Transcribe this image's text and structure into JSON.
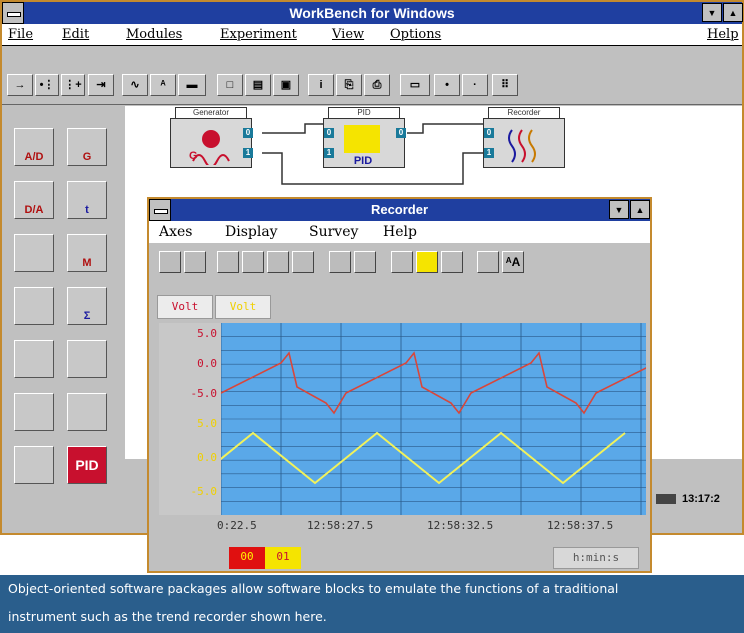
{
  "app": {
    "title": "WorkBench for Windows",
    "menu": [
      "File",
      "Edit",
      "Modules",
      "Experiment",
      "View",
      "Options"
    ],
    "help": "Help",
    "status_time": "13:17:2"
  },
  "palette": {
    "items": [
      {
        "label": "A/D"
      },
      {
        "label": "G"
      },
      {
        "label": "D/A"
      },
      {
        "label": "t"
      },
      {
        "label": ""
      },
      {
        "label": "M"
      },
      {
        "label": ""
      },
      {
        "label": "Σ"
      },
      {
        "label": ""
      },
      {
        "label": ""
      },
      {
        "label": ""
      },
      {
        "label": ""
      },
      {
        "label": ""
      },
      {
        "label": "PID"
      }
    ]
  },
  "diagram": {
    "blocks": [
      {
        "title": "Generator"
      },
      {
        "title": "PID",
        "caption": "PID"
      },
      {
        "title": "Recorder"
      }
    ],
    "port_labels": [
      "0",
      "1"
    ]
  },
  "recorder": {
    "title": "Recorder",
    "menu": [
      "Axes",
      "Display",
      "Survey",
      "Help"
    ],
    "unit_tabs": [
      "Volt",
      "Volt"
    ],
    "chart_data": {
      "type": "line",
      "yticks": [
        "5.0",
        "0.0",
        "-5.0",
        "5.0",
        "0.0",
        "-5.0"
      ],
      "xticks": [
        "0:22.5",
        "12:58:27.5",
        "12:58:32.5",
        "12:58:37.5"
      ],
      "series": [
        {
          "color": "#d9463a",
          "shape": "sawtooth"
        },
        {
          "color": "#f2f25a",
          "shape": "triangle"
        }
      ],
      "background": "#5aa8e8",
      "grid": true
    },
    "legend": [
      "00",
      "01"
    ],
    "time_format": "h:min:s"
  },
  "caption": {
    "line1": "Object-oriented software packages allow software blocks to emulate the functions of a traditional",
    "line2": "instrument such as the trend recorder shown here."
  }
}
